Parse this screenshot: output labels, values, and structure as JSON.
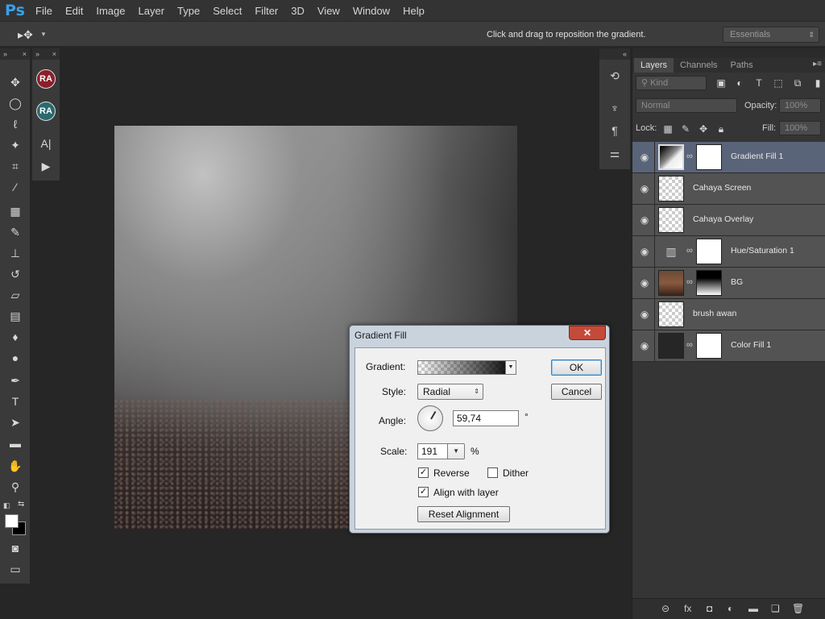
{
  "app": {
    "logo": "Ps",
    "menu": [
      "File",
      "Edit",
      "Image",
      "Layer",
      "Type",
      "Select",
      "Filter",
      "3D",
      "View",
      "Window",
      "Help"
    ]
  },
  "options_bar": {
    "hint": "Click and drag to reposition the gradient.",
    "workspace": "Essentials"
  },
  "side_badges": [
    "RA",
    "RA"
  ],
  "layers_panel": {
    "tabs": [
      "Layers",
      "Channels",
      "Paths"
    ],
    "kind_placeholder": "Kind",
    "blend_mode": "Normal",
    "opacity_label": "Opacity:",
    "opacity_value": "100%",
    "lock_label": "Lock:",
    "fill_label": "Fill:",
    "fill_value": "100%",
    "layers": [
      {
        "name": "Gradient Fill 1",
        "selected": true
      },
      {
        "name": "Cahaya Screen",
        "selected": false
      },
      {
        "name": "Cahaya Overlay",
        "selected": false
      },
      {
        "name": "Hue/Saturation 1",
        "selected": false
      },
      {
        "name": "BG",
        "selected": false
      },
      {
        "name": "brush awan",
        "selected": false
      },
      {
        "name": "Color Fill 1",
        "selected": false
      }
    ]
  },
  "dialog": {
    "title": "Gradient Fill",
    "close": "✕",
    "gradient_label": "Gradient:",
    "style_label": "Style:",
    "style_value": "Radial",
    "angle_label": "Angle:",
    "angle_value": "59,74",
    "angle_unit": "°",
    "scale_label": "Scale:",
    "scale_value": "191",
    "scale_unit": "%",
    "reverse_label": "Reverse",
    "reverse_checked": true,
    "dither_label": "Dither",
    "dither_checked": false,
    "align_label": "Align with layer",
    "align_checked": true,
    "reset_label": "Reset Alignment",
    "ok_label": "OK",
    "cancel_label": "Cancel"
  },
  "colors": {
    "accent": "#3aa0e8",
    "selected_layer": "#5a6478",
    "close_button": "#c44a3a"
  }
}
